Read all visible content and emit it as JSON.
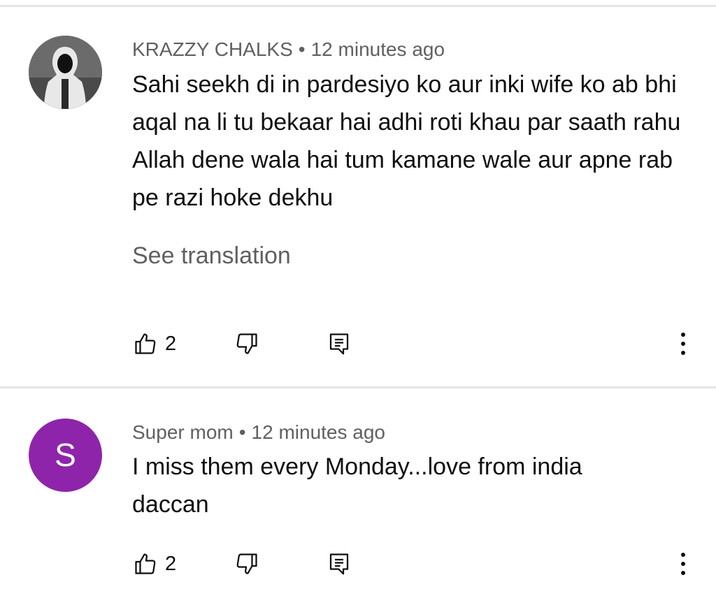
{
  "comments": [
    {
      "author": "KRAZZY CHALKS",
      "separator": "•",
      "time": "12 minutes ago",
      "text": "Sahi seekh di in pardesiyo ko aur inki wife ko ab bhi aqal na li tu bekaar hai adhi roti khau par saath rahu Allah dene wala hai tum kamane wale aur apne rab pe razi hoke dekhu",
      "see_translation": "See translation",
      "likes": "2",
      "avatar": {
        "type": "photo",
        "description_icon": "hooded-figure-icon"
      }
    },
    {
      "author": "Super mom",
      "separator": "•",
      "time": "12 minutes ago",
      "text": "I miss them every Monday...love from india daccan",
      "likes": "2",
      "avatar": {
        "type": "letter",
        "letter": "S",
        "color": "#8e24aa"
      }
    }
  ],
  "icons": {
    "like": "thumbs-up-icon",
    "dislike": "thumbs-down-icon",
    "reply": "reply-comment-icon",
    "more": "more-vertical-icon"
  },
  "colors": {
    "meta_text": "#606060",
    "body_text": "#0f0f0f",
    "divider": "#e5e5e5"
  }
}
